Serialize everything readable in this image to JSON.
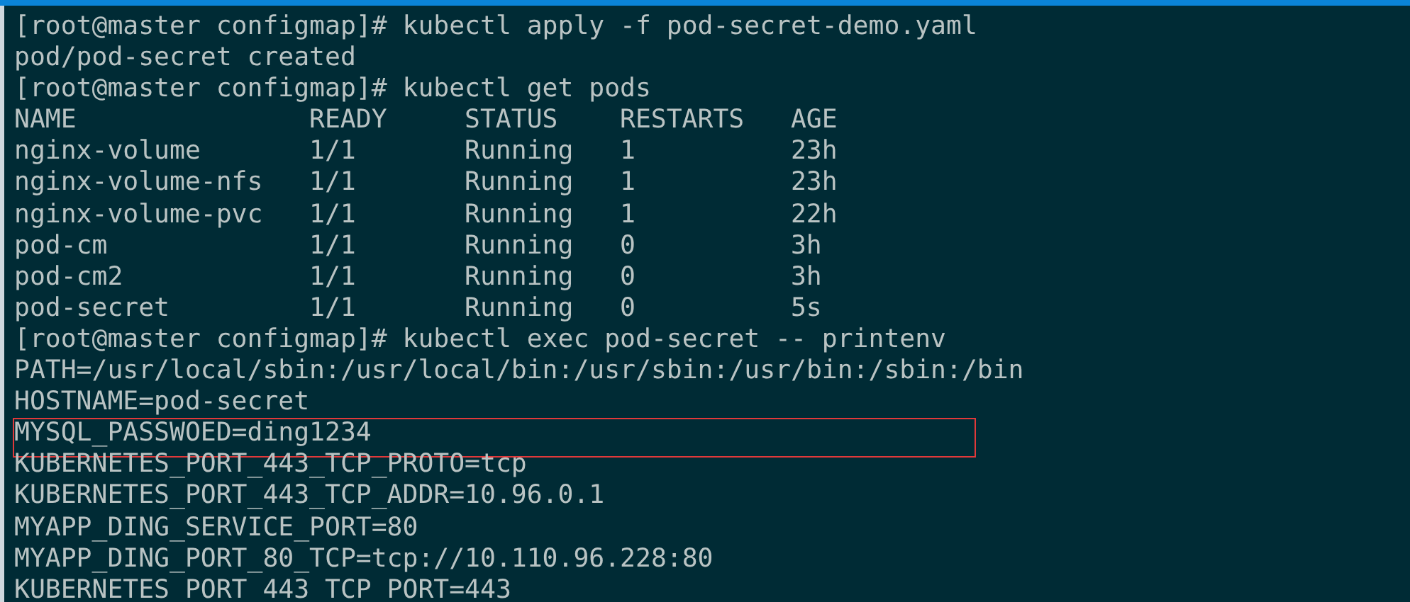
{
  "terminal": {
    "lines": [
      {
        "kind": "prompt",
        "text": "[root@master configmap]# kubectl apply -f pod-secret-demo.yaml",
        "highlighted": false
      },
      {
        "kind": "output",
        "text": "pod/pod-secret created",
        "highlighted": false
      },
      {
        "kind": "prompt",
        "text": "[root@master configmap]# kubectl get pods",
        "highlighted": false
      },
      {
        "kind": "table",
        "columns": [
          "NAME",
          "READY",
          "STATUS",
          "RESTARTS",
          "AGE"
        ],
        "rows": [
          [
            "nginx-volume",
            "1/1",
            "Running",
            "1",
            "23h"
          ],
          [
            "nginx-volume-nfs",
            "1/1",
            "Running",
            "1",
            "23h"
          ],
          [
            "nginx-volume-pvc",
            "1/1",
            "Running",
            "1",
            "22h"
          ],
          [
            "pod-cm",
            "1/1",
            "Running",
            "0",
            "3h"
          ],
          [
            "pod-cm2",
            "1/1",
            "Running",
            "0",
            "3h"
          ],
          [
            "pod-secret",
            "1/1",
            "Running",
            "0",
            "5s"
          ]
        ]
      },
      {
        "kind": "prompt",
        "text": "[root@master configmap]# kubectl exec pod-secret -- printenv",
        "highlighted": false
      },
      {
        "kind": "output",
        "text": "PATH=/usr/local/sbin:/usr/local/bin:/usr/sbin:/usr/bin:/sbin:/bin",
        "highlighted": false
      },
      {
        "kind": "output",
        "text": "HOSTNAME=pod-secret",
        "highlighted": false
      },
      {
        "kind": "output",
        "text": "MYSQL_PASSWOED=ding1234",
        "highlighted": true
      },
      {
        "kind": "output",
        "text": "KUBERNETES_PORT_443_TCP_PROTO=tcp",
        "highlighted": false
      },
      {
        "kind": "output",
        "text": "KUBERNETES_PORT_443_TCP_ADDR=10.96.0.1",
        "highlighted": false
      },
      {
        "kind": "output",
        "text": "MYAPP_DING_SERVICE_PORT=80",
        "highlighted": false
      },
      {
        "kind": "output",
        "text": "MYAPP_DING_PORT_80_TCP=tcp://10.110.96.228:80",
        "highlighted": false
      },
      {
        "kind": "output",
        "text": "KUBERNETES_PORT_443_TCP_PORT=443",
        "highlighted": false
      }
    ]
  }
}
